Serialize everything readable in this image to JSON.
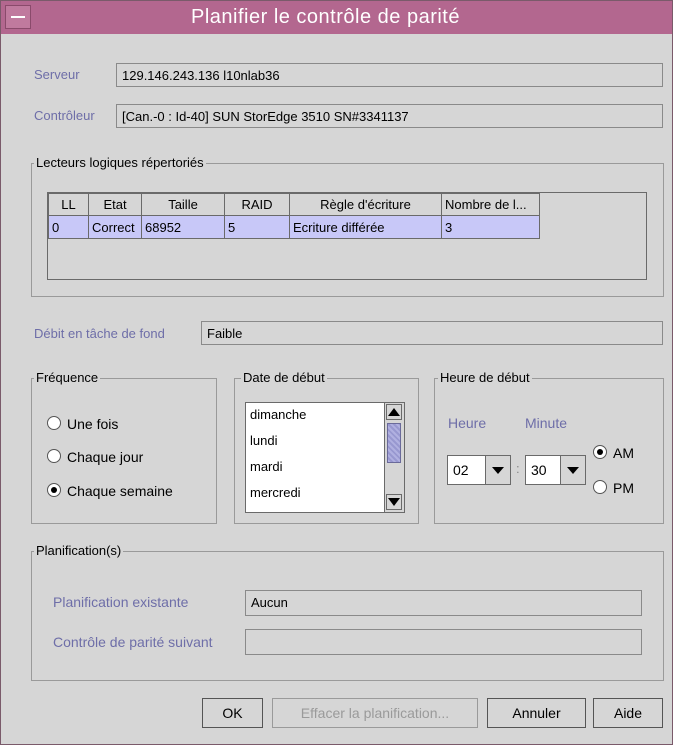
{
  "window": {
    "title": "Planifier le contrôle de parité"
  },
  "server": {
    "label": "Serveur",
    "value": "129.146.243.136 l10nlab36"
  },
  "controller": {
    "label": "Contrôleur",
    "value": "[Can.-0 : Id-40] SUN StorEdge 3510 SN#3341137"
  },
  "logical_drives": {
    "title": "Lecteurs logiques répertoriés",
    "columns": [
      "LL",
      "Etat",
      "Taille",
      "RAID",
      "Règle d'écriture",
      "Nombre de l..."
    ],
    "rows": [
      [
        "0",
        "Correct",
        "68952",
        "5",
        "Ecriture différée",
        "3"
      ]
    ]
  },
  "background_rate": {
    "label": "Débit en tâche de fond",
    "value": "Faible"
  },
  "frequency": {
    "title": "Fréquence",
    "options": [
      "Une fois",
      "Chaque jour",
      "Chaque semaine"
    ],
    "selected_index": 2
  },
  "start_date": {
    "title": "Date de début",
    "days": [
      "dimanche",
      "lundi",
      "mardi",
      "mercredi"
    ]
  },
  "start_time": {
    "title": "Heure de début",
    "hour_label": "Heure",
    "minute_label": "Minute",
    "hour_value": "02",
    "separator": ":",
    "minute_value": "30",
    "am_label": "AM",
    "pm_label": "PM",
    "selected": "AM"
  },
  "schedules": {
    "title": "Planification(s)",
    "existing_label": "Planification existante",
    "existing_value": "Aucun",
    "next_label": "Contrôle de parité suivant",
    "next_value": ""
  },
  "buttons": {
    "ok": "OK",
    "clear": "Effacer la planification...",
    "cancel": "Annuler",
    "help": "Aide"
  }
}
